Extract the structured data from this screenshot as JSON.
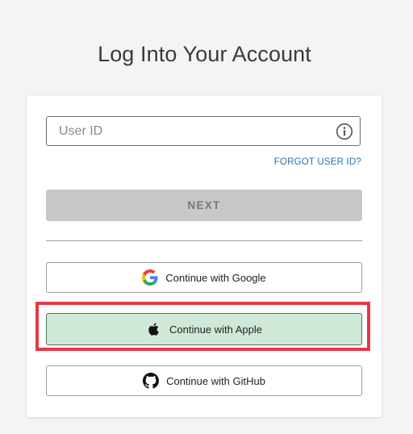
{
  "page": {
    "title": "Log Into Your Account"
  },
  "login_form": {
    "userid_placeholder": "User ID",
    "userid_value": "",
    "forgot_link": "FORGOT USER ID?",
    "next_label": "NEXT"
  },
  "sso": {
    "google_label": "Continue with Google",
    "apple_label": "Continue with Apple",
    "github_label": "Continue with GitHub"
  },
  "icons": {
    "info": "info-icon",
    "google": "google-logo-icon",
    "apple": "apple-logo-icon",
    "github": "github-logo-icon"
  },
  "colors": {
    "background": "#f4f4f4",
    "link": "#2a6fb1",
    "next_disabled_bg": "#c8c8c8",
    "apple_selected_bg": "#cfe8d7",
    "highlight": "#e63946"
  }
}
